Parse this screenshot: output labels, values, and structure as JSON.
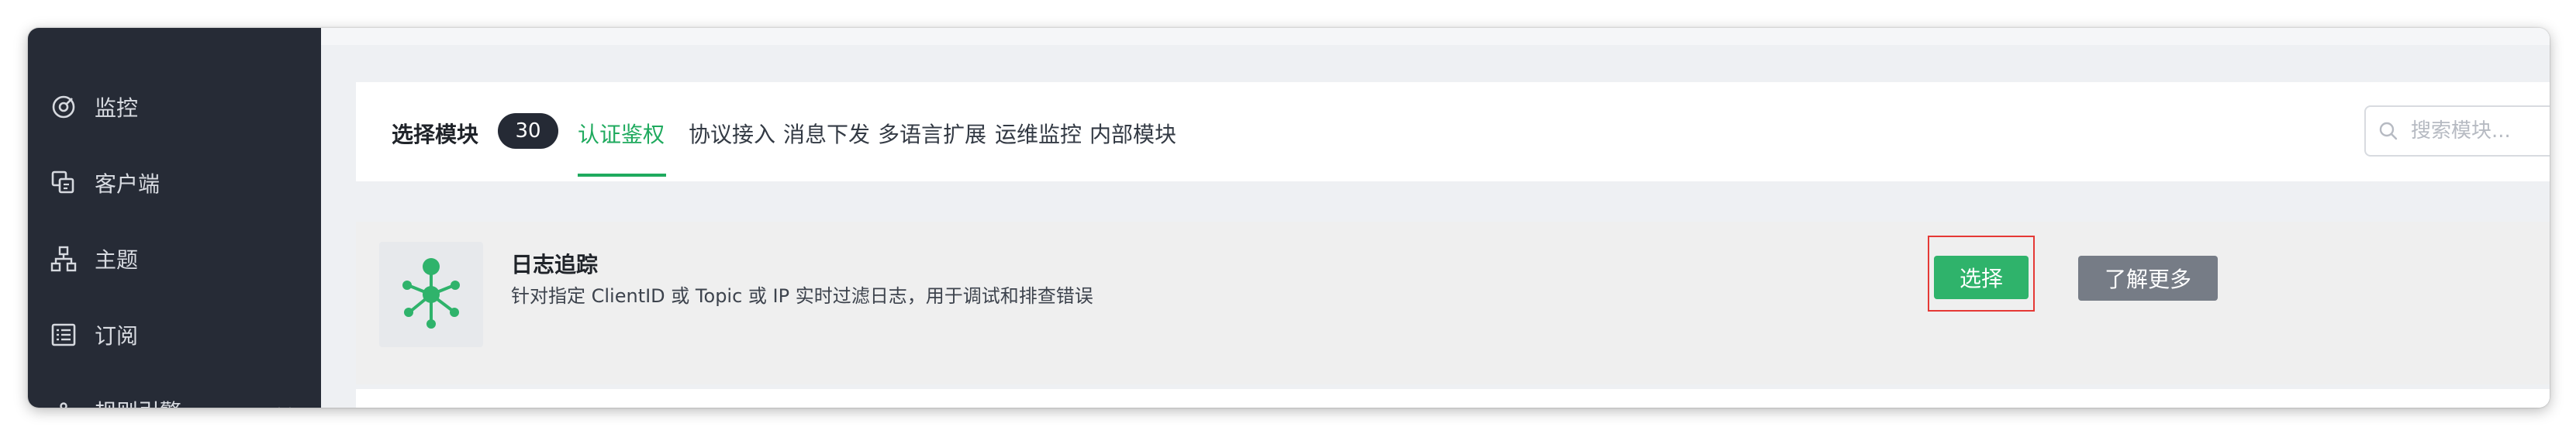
{
  "sidebar": {
    "items": [
      {
        "label": "监控",
        "icon": "monitor-gauge-icon"
      },
      {
        "label": "客户端",
        "icon": "clients-icon"
      },
      {
        "label": "主题",
        "icon": "topics-tree-icon"
      },
      {
        "label": "订阅",
        "icon": "subscriptions-list-icon"
      },
      {
        "label": "规则引擎",
        "icon": "rule-engine-icon",
        "expandable": true
      }
    ]
  },
  "tabs": {
    "title": "选择模块",
    "count": "30",
    "items": [
      {
        "label": "认证鉴权",
        "active": true
      },
      {
        "label": "协议接入",
        "active": false
      },
      {
        "label": "消息下发",
        "active": false
      },
      {
        "label": "多语言扩展",
        "active": false
      },
      {
        "label": "运维监控",
        "active": false
      },
      {
        "label": "内部模块",
        "active": false
      }
    ]
  },
  "search": {
    "placeholder": "搜索模块...",
    "value": ""
  },
  "module": {
    "name": "日志追踪",
    "description": "针对指定 ClientID 或 Topic 或 IP 实时过滤日志，用于调试和排查错误",
    "icon": "log-trace-network-icon",
    "select_label": "选择",
    "more_label": "了解更多"
  },
  "colors": {
    "sidebar_bg": "#262b36",
    "accent": "#1faa5e",
    "select_button": "#2fb36b",
    "more_button": "#767c86",
    "highlight_border": "#e53935"
  }
}
